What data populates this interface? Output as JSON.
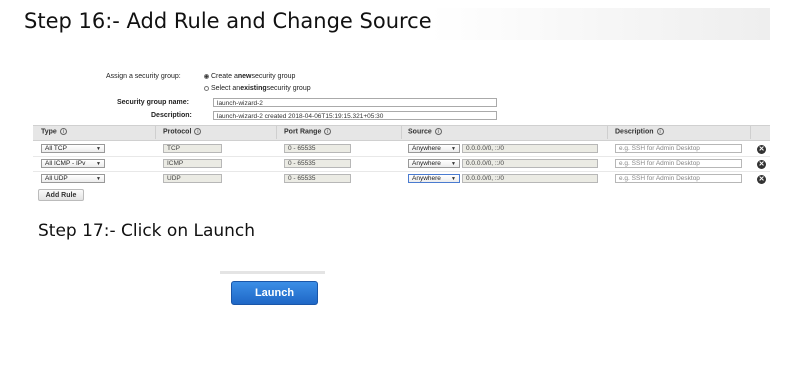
{
  "steps": {
    "step16_title": "Step 16:- Add Rule and Change Source",
    "step17_title": "Step 17:- Click on Launch"
  },
  "security_group": {
    "assign_label": "Assign a security group:",
    "option_create_pre": "Create a ",
    "option_create_bold": "new",
    "option_create_post": " security group",
    "option_existing_pre": "Select an ",
    "option_existing_bold": "existing",
    "option_existing_post": " security group",
    "selected_option": "create",
    "name_label": "Security group name:",
    "name_value": "launch-wizard-2",
    "description_label": "Description:",
    "description_value": "launch-wizard-2 created 2018-04-06T15:19:15.321+05:30"
  },
  "table": {
    "headers": [
      "Type",
      "Protocol",
      "Port Range",
      "Source",
      "Description"
    ],
    "info_icon": "i",
    "rows": [
      {
        "type": "All TCP",
        "protocol": "TCP",
        "port_range": "0 - 65535",
        "source": "Anywhere",
        "cidr": "0.0.0.0/0, ::/0",
        "description_placeholder": "e.g. SSH for Admin Desktop"
      },
      {
        "type": "All ICMP - IPv",
        "protocol": "ICMP",
        "port_range": "0 - 65535",
        "source": "Anywhere",
        "cidr": "0.0.0.0/0, ::/0",
        "description_placeholder": "e.g. SSH for Admin Desktop"
      },
      {
        "type": "All UDP",
        "protocol": "UDP",
        "port_range": "0 - 65535",
        "source": "Anywhere",
        "cidr": "0.0.0.0/0, ::/0",
        "description_placeholder": "e.g. SSH for Admin Desktop"
      }
    ],
    "delete_glyph": "✕",
    "add_rule_label": "Add Rule"
  },
  "launch": {
    "button_label": "Launch",
    "button_color": "#2472d6"
  },
  "icons": {
    "info": "info-circle-icon",
    "delete": "remove-circle-icon",
    "dropdown": "caret-down-icon"
  }
}
